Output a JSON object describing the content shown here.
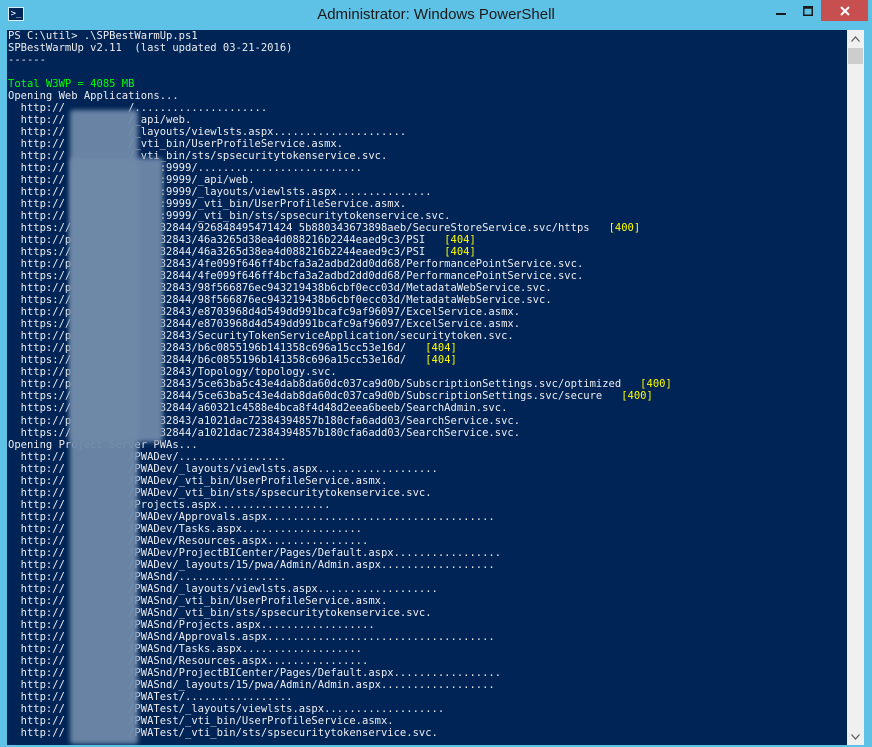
{
  "window": {
    "title": "Administrator: Windows PowerShell",
    "icon": "powershell-icon",
    "icon_glyph": ">_",
    "accent_color": "#5ec1e6",
    "close_color": "#c74f50",
    "controls": [
      "minimize-icon",
      "maximize-icon",
      "close-icon"
    ]
  },
  "console": {
    "background": "#012456",
    "lines": [
      {
        "text": "PS C:\\util> .\\SPBestWarmUp.ps1"
      },
      {
        "text": "SPBestWarmUp v2.11  (last updated 03-21-2016)"
      },
      {
        "text": "------"
      },
      {
        "text": ""
      },
      {
        "text": "Total W3WP = 4085 MB",
        "color": "green"
      },
      {
        "text": "Opening Web Applications..."
      },
      {
        "text": "  http://          /....................."
      },
      {
        "text": "  http://          /_api/web."
      },
      {
        "text": "  http://          /_layouts/viewlsts.aspx....................."
      },
      {
        "text": "  http://          /_vti_bin/UserProfileService.asmx."
      },
      {
        "text": "  http://          /_vti_bin/sts/spsecuritytokenservice.svc."
      },
      {
        "text": "  http://               :9999/.........................."
      },
      {
        "text": "  http://               :9999/_api/web."
      },
      {
        "text": "  http://               :9999/_layouts/viewlsts.aspx..............."
      },
      {
        "text": "  http://               :9999/_vti_bin/UserProfileService.asmx."
      },
      {
        "text": "  http://               :9999/_vti_bin/sts/spsecuritytokenservice.svc."
      },
      {
        "text": "  https://              32844/926848495471424 5b880343673898aeb/SecureStoreService.svc/https",
        "tag": "[400]"
      },
      {
        "text": "  http://p              32843/46a3265d38ea4d088216b2244eaed9c3/PSI",
        "tag": "[404]"
      },
      {
        "text": "  https://              32844/46a3265d38ea4d088216b2244eaed9c3/PSI",
        "tag": "[404]"
      },
      {
        "text": "  http://p              32843/4fe099f646ff4bcfa3a2adbd2dd0dd68/PerformancePointService.svc."
      },
      {
        "text": "  https://              32844/4fe099f646ff4bcfa3a2adbd2dd0dd68/PerformancePointService.svc."
      },
      {
        "text": "  http://p              32843/98f566876ec943219438b6cbf0ecc03d/MetadataWebService.svc."
      },
      {
        "text": "  https://              32844/98f566876ec943219438b6cbf0ecc03d/MetadataWebService.svc."
      },
      {
        "text": "  http://p              32843/e8703968d4d549dd991bcafc9af96097/ExcelService.asmx."
      },
      {
        "text": "  https://              32844/e8703968d4d549dd991bcafc9af96097/ExcelService.asmx."
      },
      {
        "text": "  http://p              32843/SecurityTokenServiceApplication/securitytoken.svc."
      },
      {
        "text": "  http://p              32843/b6c0855196b141358c696a15cc53e16d/",
        "tag": "[404]"
      },
      {
        "text": "  https://              32844/b6c0855196b141358c696a15cc53e16d/",
        "tag": "[404]"
      },
      {
        "text": "  http://p              32843/Topology/topology.svc."
      },
      {
        "text": "  http://p              32843/5ce63ba5c43e4dab8da60dc037ca9d0b/SubscriptionSettings.svc/optimized",
        "tag": "[400]"
      },
      {
        "text": "  https://              32844/5ce63ba5c43e4dab8da60dc037ca9d0b/SubscriptionSettings.svc/secure",
        "tag": "[400]"
      },
      {
        "text": "  https://              32844/a60321c4588e4bca8f4d48d2eea6beeb/SearchAdmin.svc."
      },
      {
        "text": "  http://p              32843/a1021dac72384394857b180cfa6add03/SearchService.svc."
      },
      {
        "text": "  https://              32844/a1021dac72384394857b180cfa6add03/SearchService.svc."
      },
      {
        "text": "Opening Project Server PWAs..."
      },
      {
        "text": "  http://          /PWADev/................."
      },
      {
        "text": "  http://          /PWADev/_layouts/viewlsts.aspx..................."
      },
      {
        "text": "  http://          /PWADev/_vti_bin/UserProfileService.asmx."
      },
      {
        "text": "  http://          /PWADev/_vti_bin/sts/spsecuritytokenservice.svc."
      },
      {
        "text": "  http://          /Projects.aspx.................."
      },
      {
        "text": "  http://          /PWADev/Approvals.aspx...................................."
      },
      {
        "text": "  http://          /PWADev/Tasks.aspx..................."
      },
      {
        "text": "  http://          /PWADev/Resources.aspx................"
      },
      {
        "text": "  http://          /PWADev/ProjectBICenter/Pages/Default.aspx................."
      },
      {
        "text": "  http://          /PWADev/_layouts/15/pwa/Admin/Admin.aspx.................."
      },
      {
        "text": "  http://          /PWASnd/................."
      },
      {
        "text": "  http://          /PWASnd/_layouts/viewlsts.aspx..................."
      },
      {
        "text": "  http://          /PWASnd/_vti_bin/UserProfileService.asmx."
      },
      {
        "text": "  http://          /PWASnd/_vti_bin/sts/spsecuritytokenservice.svc."
      },
      {
        "text": "  http://          /PWASnd/Projects.aspx.................."
      },
      {
        "text": "  http://          /PWASnd/Approvals.aspx...................................."
      },
      {
        "text": "  http://          /PWASnd/Tasks.aspx..................."
      },
      {
        "text": "  http://          /PWASnd/Resources.aspx................"
      },
      {
        "text": "  http://          /PWASnd/ProjectBICenter/Pages/Default.aspx................."
      },
      {
        "text": "  http://          /PWASnd/_layouts/15/pwa/Admin/Admin.aspx.................."
      },
      {
        "text": "  http://          /PWATest/................."
      },
      {
        "text": "  http://          /PWATest/_layouts/viewlsts.aspx..................."
      },
      {
        "text": "  http://          /PWATest/_vti_bin/UserProfileService.asmx."
      },
      {
        "text": "  http://          /PWATest/_vti_bin/sts/spsecuritytokenservice.svc."
      }
    ]
  },
  "scrollbar": {
    "up_icon": "scroll-up-icon",
    "down_icon": "scroll-down-icon"
  }
}
